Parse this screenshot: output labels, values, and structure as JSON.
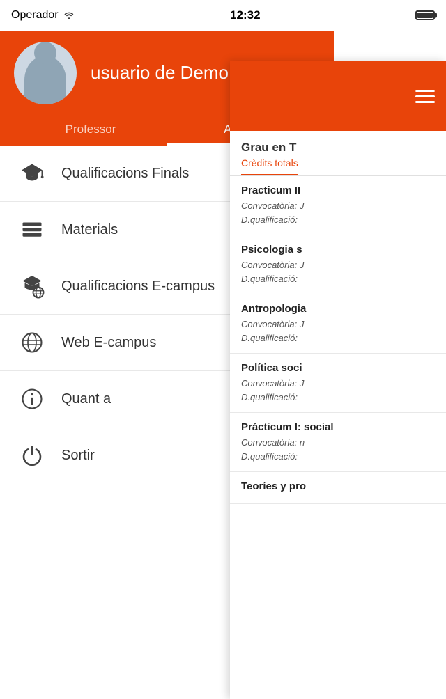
{
  "statusBar": {
    "operator": "Operador",
    "time": "12:32"
  },
  "header": {
    "userName": "usuario de Demo",
    "tabs": [
      {
        "id": "professor",
        "label": "Professor",
        "active": false
      },
      {
        "id": "alumne",
        "label": "Alumne",
        "active": true
      }
    ]
  },
  "menuItems": [
    {
      "id": "qualificacions-finals",
      "label": "Qualificacions Finals",
      "icon": "graduation-cap"
    },
    {
      "id": "materials",
      "label": "Materials",
      "icon": "books"
    },
    {
      "id": "qualificacions-ecampus",
      "label": "Qualificacions E-campus",
      "icon": "graduation-globe"
    },
    {
      "id": "web-ecampus",
      "label": "Web E-campus",
      "icon": "globe"
    },
    {
      "id": "quant-a",
      "label": "Quant a",
      "icon": "info-circle"
    },
    {
      "id": "sortir",
      "label": "Sortir",
      "icon": "power"
    }
  ],
  "rightPanel": {
    "title": "Grau en T",
    "subtitle": "Crèdits totals",
    "courses": [
      {
        "id": "practicum-ii",
        "name": "Practicum II",
        "convocatoria": "Convocatòria: J",
        "dqualificacio": "D.qualificació:"
      },
      {
        "id": "psicologia-s",
        "name": "Psicologia s",
        "convocatoria": "Convocatòria: J",
        "dqualificacio": "D.qualificació:"
      },
      {
        "id": "antropologia",
        "name": "Antropologia",
        "convocatoria": "Convocatòria: J",
        "dqualificacio": "D.qualificació:"
      },
      {
        "id": "politica-soci",
        "name": "Política soci",
        "convocatoria": "Convocatòria: J",
        "dqualificacio": "D.qualificació:"
      },
      {
        "id": "practicum-i-social",
        "name": "Prácticum I: social",
        "convocatoria": "Convocatòria: n",
        "dqualificacio": "D.qualificació:"
      },
      {
        "id": "theories-pro",
        "name": "Teoríes y pro",
        "convocatoria": "",
        "dqualificacio": ""
      }
    ]
  }
}
